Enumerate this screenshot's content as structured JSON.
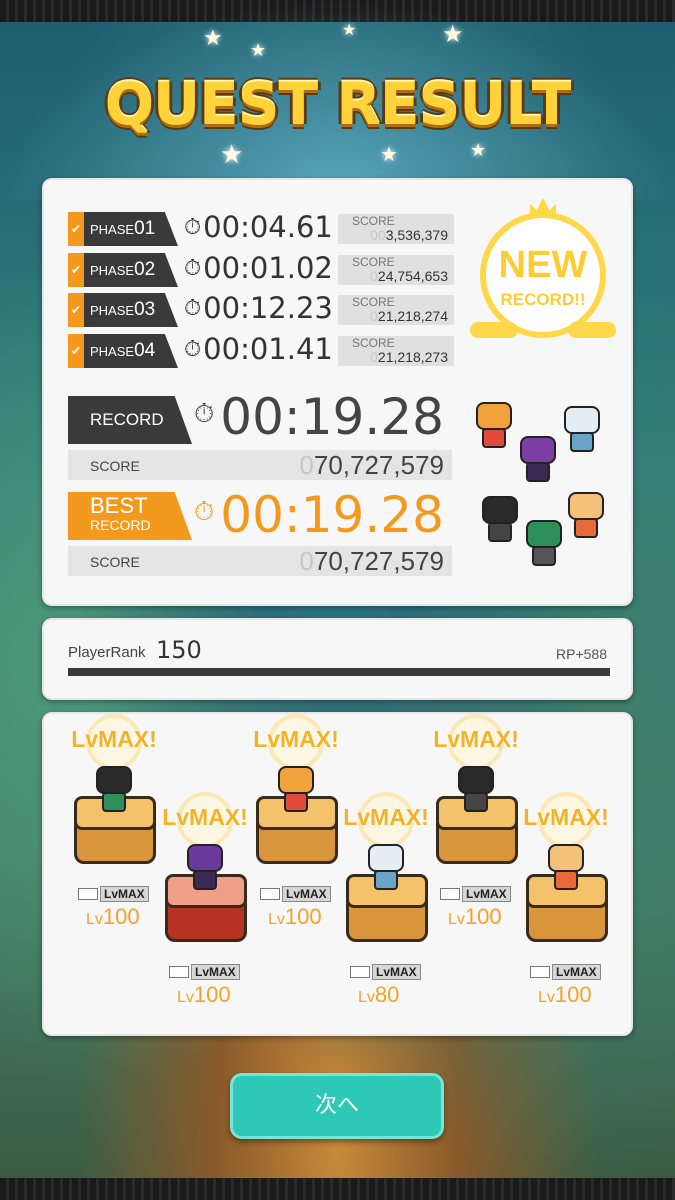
{
  "title": "QUEST RESULT",
  "phases": [
    {
      "label_prefix": "PHASE",
      "num": "01",
      "time": "00:04.61",
      "score_label": "SCORE",
      "score_pad": "00",
      "score": "3,536,379"
    },
    {
      "label_prefix": "PHASE",
      "num": "02",
      "time": "00:01.02",
      "score_label": "SCORE",
      "score_pad": "0",
      "score": "24,754,653"
    },
    {
      "label_prefix": "PHASE",
      "num": "03",
      "time": "00:12.23",
      "score_label": "SCORE",
      "score_pad": "0",
      "score": "21,218,274"
    },
    {
      "label_prefix": "PHASE",
      "num": "04",
      "time": "00:01.41",
      "score_label": "SCORE",
      "score_pad": "0",
      "score": "21,218,273"
    }
  ],
  "record": {
    "label": "RECORD",
    "time": "00:19.28",
    "score_label": "SCORE",
    "score_pad": "0",
    "score": "70,727,579"
  },
  "best": {
    "label_line1": "BEST",
    "label_line2": "RECORD",
    "time": "00:19.28",
    "score_label": "SCORE",
    "score_pad": "0",
    "score": "70,727,579"
  },
  "new_record": {
    "line1": "NEW",
    "line2": "RECORD!!"
  },
  "rank": {
    "label": "PlayerRank",
    "value": "150",
    "rp": "RP+588"
  },
  "team": [
    {
      "badge": "LvMAX!",
      "tag": "LvMAX",
      "lv_prefix": "Lv",
      "level": "100",
      "pedestal": "gold"
    },
    {
      "badge": "LvMAX!",
      "tag": "LvMAX",
      "lv_prefix": "Lv",
      "level": "100",
      "pedestal": "red"
    },
    {
      "badge": "LvMAX!",
      "tag": "LvMAX",
      "lv_prefix": "Lv",
      "level": "100",
      "pedestal": "gold"
    },
    {
      "badge": "LvMAX!",
      "tag": "LvMAX",
      "lv_prefix": "Lv",
      "level": "80",
      "pedestal": "gold"
    },
    {
      "badge": "LvMAX!",
      "tag": "LvMAX",
      "lv_prefix": "Lv",
      "level": "100",
      "pedestal": "gold"
    },
    {
      "badge": "LvMAX!",
      "tag": "LvMAX",
      "lv_prefix": "Lv",
      "level": "100",
      "pedestal": "gold"
    }
  ],
  "next_button": "次へ",
  "colors": {
    "accent_orange": "#f39a1e",
    "dark": "#3a3a3a",
    "teal_button": "#2ec8b6",
    "gold": "#ffd23a"
  }
}
